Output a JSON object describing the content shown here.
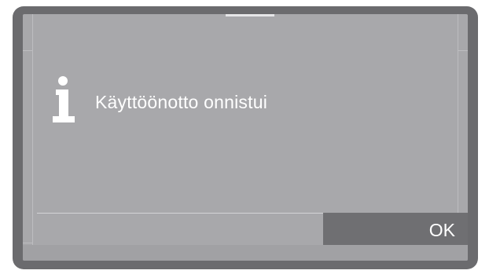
{
  "dialog": {
    "icon": "info-icon",
    "message": "Käyttöönotto onnistui",
    "ok_label": "OK"
  },
  "colors": {
    "frame": "#6b6b6e",
    "screen": "#a8a8ab",
    "button": "#6f6f72",
    "text": "#ffffff"
  }
}
